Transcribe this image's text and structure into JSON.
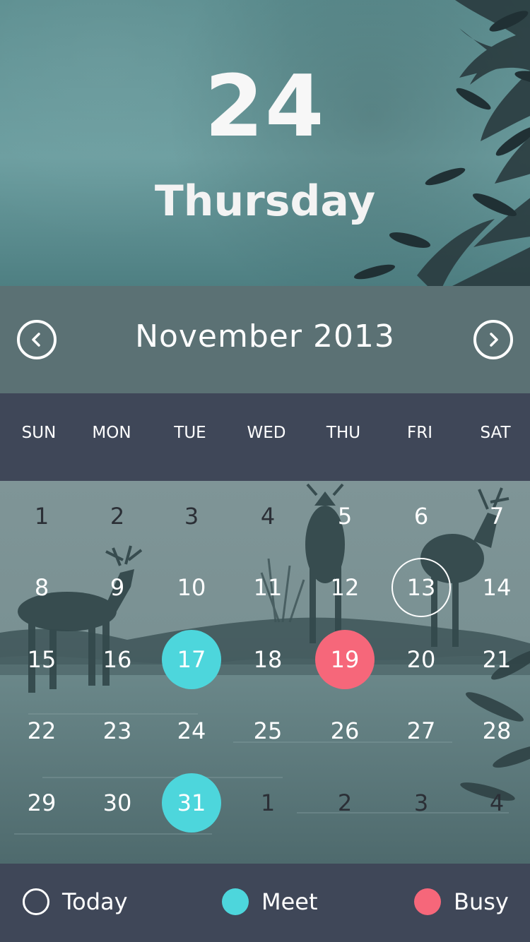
{
  "header": {
    "day_number": "24",
    "weekday": "Thursday"
  },
  "month_bar": {
    "title": "November 2013",
    "prev_icon": "chevron-left-icon",
    "next_icon": "chevron-right-icon"
  },
  "weekdays": [
    "SUN",
    "MON",
    "TUE",
    "WED",
    "THU",
    "FRI",
    "SAT"
  ],
  "days": [
    [
      {
        "n": "1",
        "muted": true
      },
      {
        "n": "2",
        "muted": true
      },
      {
        "n": "3",
        "muted": true
      },
      {
        "n": "4",
        "muted": true
      },
      {
        "n": "5",
        "muted": false
      },
      {
        "n": "6",
        "muted": false
      },
      {
        "n": "7",
        "muted": false
      }
    ],
    [
      {
        "n": "8"
      },
      {
        "n": "9"
      },
      {
        "n": "10"
      },
      {
        "n": "11"
      },
      {
        "n": "12"
      },
      {
        "n": "13",
        "mark": "today"
      },
      {
        "n": "14"
      }
    ],
    [
      {
        "n": "15"
      },
      {
        "n": "16"
      },
      {
        "n": "17",
        "mark": "meet"
      },
      {
        "n": "18"
      },
      {
        "n": "19",
        "mark": "busy"
      },
      {
        "n": "20"
      },
      {
        "n": "21"
      }
    ],
    [
      {
        "n": "22"
      },
      {
        "n": "23"
      },
      {
        "n": "24"
      },
      {
        "n": "25"
      },
      {
        "n": "26"
      },
      {
        "n": "27"
      },
      {
        "n": "28"
      }
    ],
    [
      {
        "n": "29"
      },
      {
        "n": "30"
      },
      {
        "n": "31",
        "mark": "meet"
      },
      {
        "n": "1",
        "muted": true
      },
      {
        "n": "2",
        "muted": true
      },
      {
        "n": "3",
        "muted": true
      },
      {
        "n": "4",
        "muted": true
      }
    ]
  ],
  "legend": {
    "today": "Today",
    "meet": "Meet",
    "busy": "Busy"
  },
  "colors": {
    "meet": "#4dd6dc",
    "busy": "#f6677a",
    "today_ring": "#ffffff",
    "muted_text": "#2b2f36",
    "text": "#ffffff"
  }
}
